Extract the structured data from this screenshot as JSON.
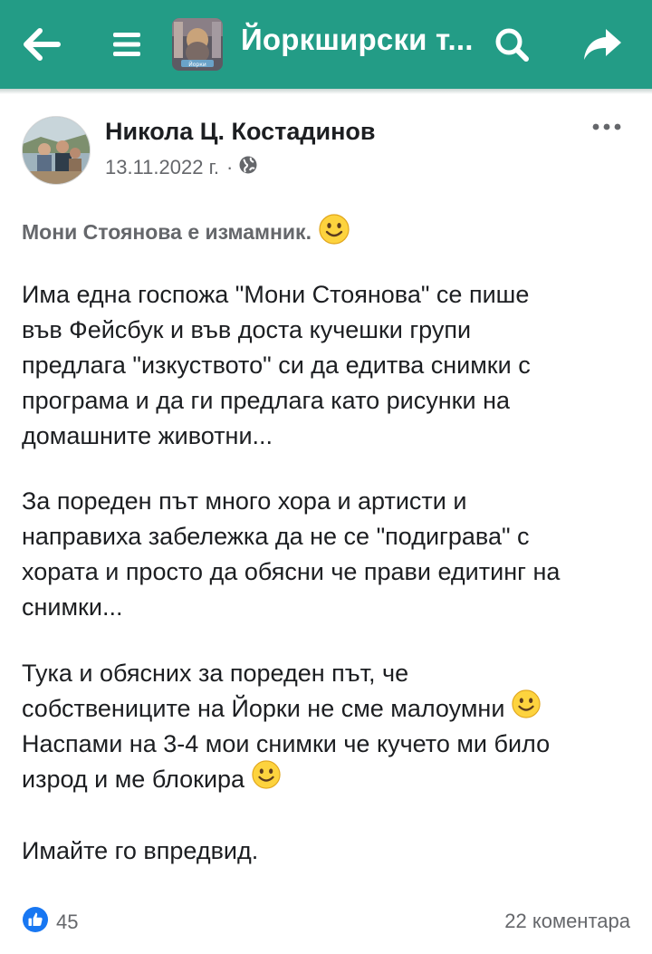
{
  "header": {
    "title": "Йоркширски т...",
    "thumb_label": "Йорки",
    "icons": [
      "back-arrow-icon",
      "menu-icon",
      "search-icon",
      "share-icon"
    ],
    "bg_color": "#239c86"
  },
  "post": {
    "author": "Никола Ц. Костадинов",
    "date": "13.11.2022 г.",
    "separator": "·",
    "privacy_icon": "globe-icon",
    "more_icon": "more-dots-icon",
    "headline": "Мони Стоянова е измамник.",
    "paragraphs": {
      "p1": [
        "Има една госпожа \"Мони Стоянова\" се пише",
        "във Фейсбук и във доста кучешки групи",
        "предлага \"изкуството\" си да едитва снимки с",
        "програма и да ги предлага като рисунки на",
        "домашните животни..."
      ],
      "p2": [
        "За пореден път много хора и артисти и",
        "направиха забележка да не се \"подиграва\" с",
        "хората и просто да обясни че прави едитинг на",
        "снимки..."
      ],
      "p3": [
        "Тука и обясних за пореден път, че",
        "собствениците на Йорки не сме малоумни",
        "Наспами на 3-4 мои снимки че кучето ми било",
        "изрод и ме блокира"
      ],
      "p4": [
        "Имайте го впредвид."
      ]
    }
  },
  "footer": {
    "like_count": "45",
    "comments": "22 коментара",
    "like_color": "#1877f2"
  }
}
